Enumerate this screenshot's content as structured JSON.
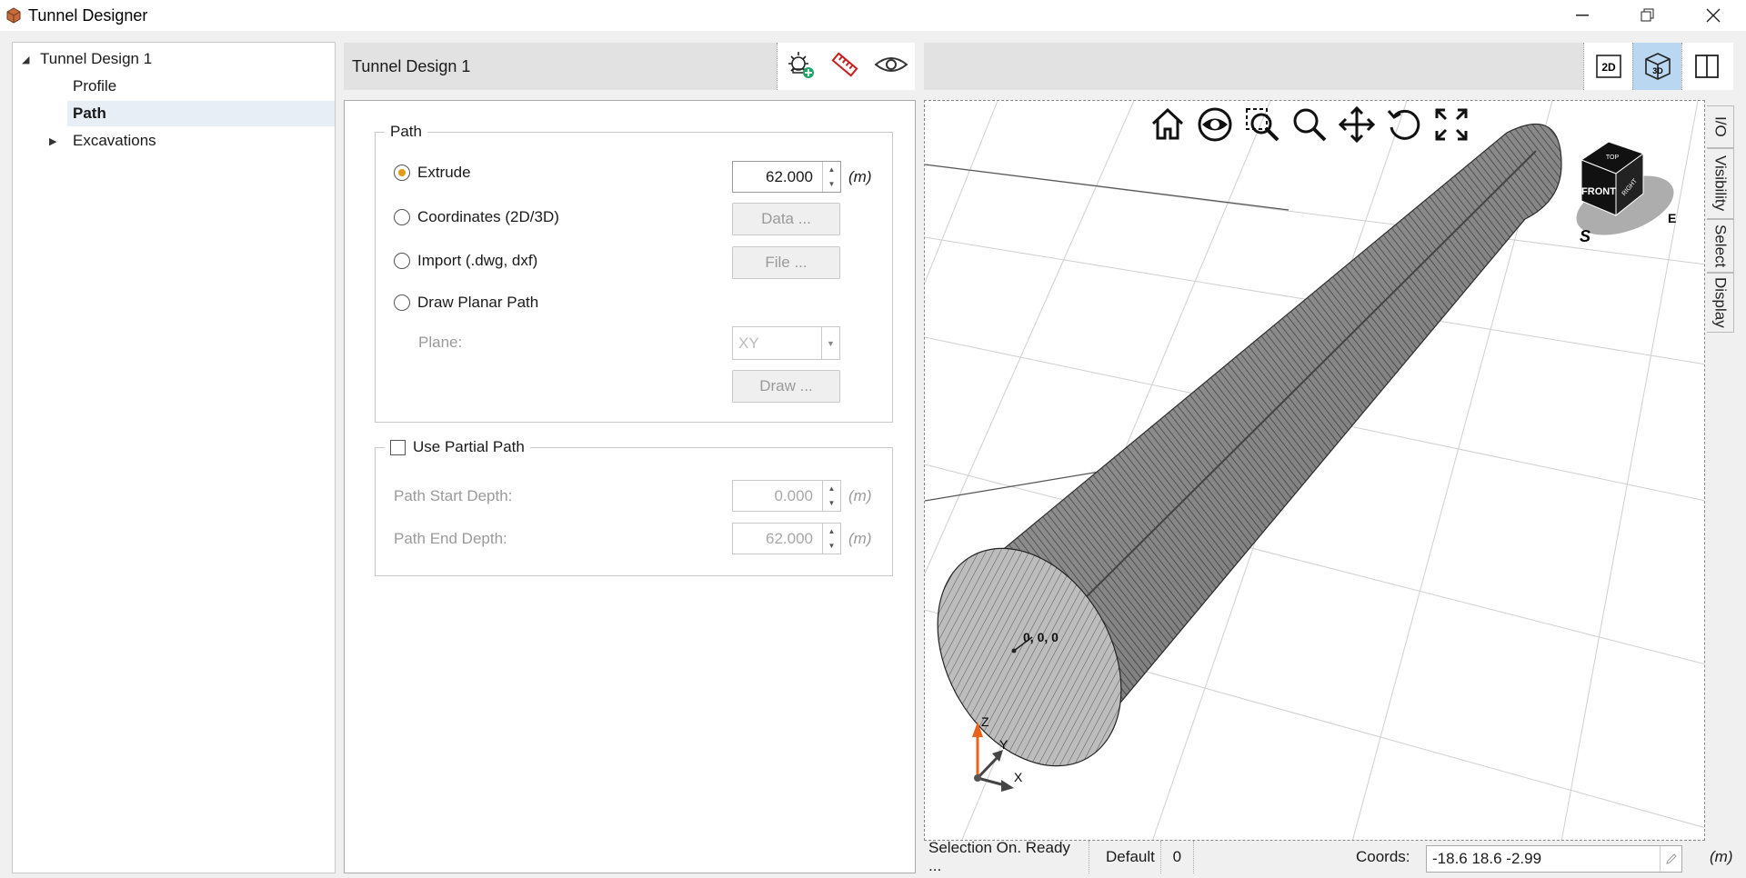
{
  "window": {
    "title": "Tunnel Designer"
  },
  "tree": {
    "root": "Tunnel Design 1",
    "items": [
      {
        "label": "Profile"
      },
      {
        "label": "Path"
      },
      {
        "label": "Excavations"
      }
    ]
  },
  "panel": {
    "header_title": "Tunnel Design 1"
  },
  "path_group": {
    "legend": "Path",
    "options": [
      {
        "label": "Extrude",
        "selected": true
      },
      {
        "label": "Coordinates (2D/3D)",
        "selected": false
      },
      {
        "label": "Import (.dwg, dxf)",
        "selected": false
      },
      {
        "label": "Draw Planar Path",
        "selected": false
      }
    ],
    "extrude_value": "62.000",
    "unit": "(m)",
    "data_button": "Data ...",
    "file_button": "File ...",
    "plane_label": "Plane:",
    "plane_value": "XY",
    "draw_button": "Draw ..."
  },
  "partial_group": {
    "legend": "Use Partial Path",
    "start_label": "Path Start Depth:",
    "start_value": "0.000",
    "end_label": "Path End Depth:",
    "end_value": "62.000",
    "unit": "(m)"
  },
  "view_toggle": {
    "two_d": "2D",
    "three_d": "3D"
  },
  "viewport": {
    "origin_label": "0, 0, 0",
    "axis_z": "Z",
    "axis_y": "Y",
    "axis_x": "X",
    "cube_front": "FRONT",
    "cube_top": "TOP",
    "cube_right": "RIGHT",
    "compass_s": "S",
    "compass_e": "E"
  },
  "side_tabs": [
    "I/O",
    "Visibility",
    "Select",
    "Display"
  ],
  "status": {
    "selection": "Selection On. Ready ...",
    "layer": "Default",
    "count": "0",
    "coords_label": "Coords:",
    "coords_value": "-18.6 18.6 -2.99",
    "unit": "(m)"
  },
  "colors": {
    "accent_radio": "#e39b16",
    "active_view": "#b9d7f0",
    "axis_z": "#e8621a"
  }
}
